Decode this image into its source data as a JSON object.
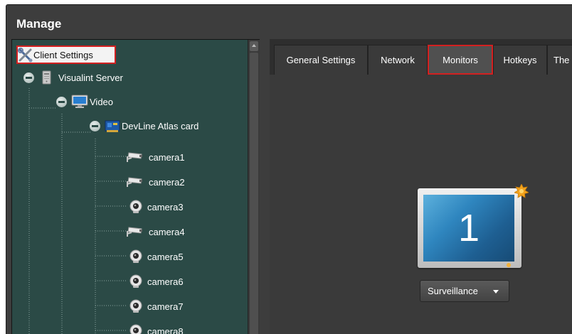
{
  "window": {
    "title": "Manage"
  },
  "tree": {
    "client_settings": {
      "label": "Client Settings",
      "icon": "tools-icon"
    },
    "server": {
      "label": "Visualint Server",
      "icon": "server-icon"
    },
    "video": {
      "label": "Video",
      "icon": "monitor-icon"
    },
    "card": {
      "label": "DevLine Atlas card",
      "icon": "capture-card-icon"
    },
    "cameras": [
      {
        "label": "camera1",
        "icon": "cctv-camera-icon"
      },
      {
        "label": "camera2",
        "icon": "cctv-camera-icon"
      },
      {
        "label": "camera3",
        "icon": "webcam-icon"
      },
      {
        "label": "camera4",
        "icon": "cctv-camera-icon"
      },
      {
        "label": "camera5",
        "icon": "webcam-icon"
      },
      {
        "label": "camera6",
        "icon": "webcam-icon"
      },
      {
        "label": "camera7",
        "icon": "webcam-icon"
      },
      {
        "label": "camera8",
        "icon": "webcam-icon"
      }
    ]
  },
  "tabs": [
    {
      "label": "General Settings",
      "active": false
    },
    {
      "label": "Network",
      "active": false
    },
    {
      "label": "Monitors",
      "active": true
    },
    {
      "label": "Hotkeys",
      "active": false
    },
    {
      "label": "The",
      "active": false
    }
  ],
  "monitor": {
    "number": "1",
    "mode": "Surveillance"
  },
  "colors": {
    "highlight": "#d32020",
    "tree_bg": "#2b4a46",
    "screen": "#2f86bf",
    "badge": "#f2a21d"
  }
}
